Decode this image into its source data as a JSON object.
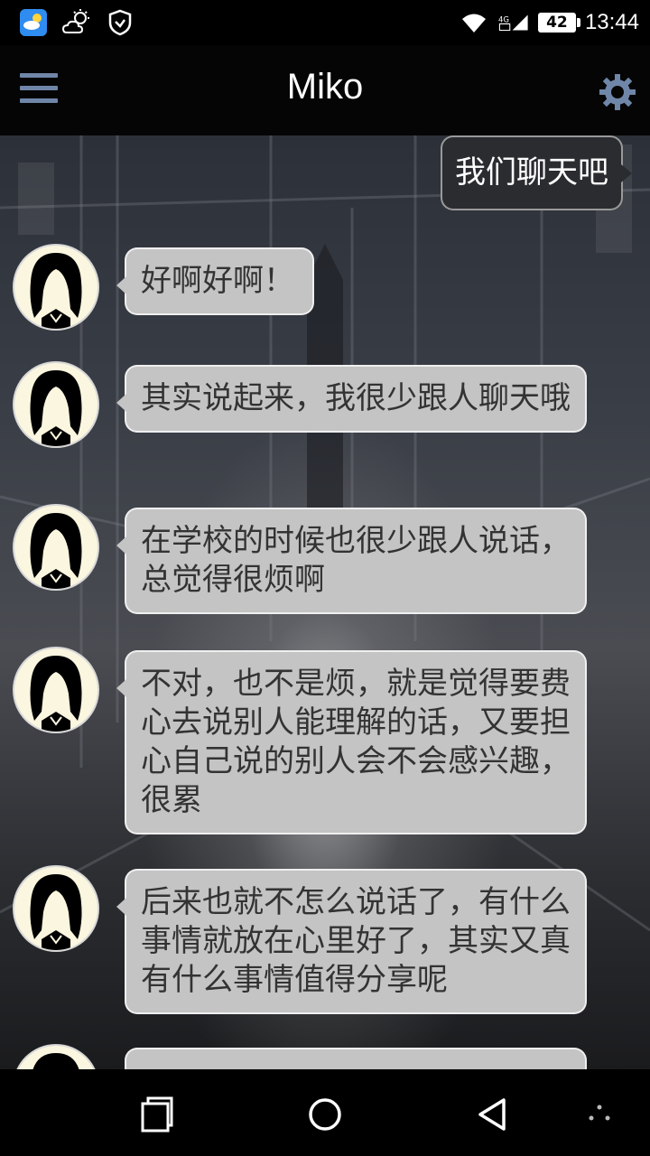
{
  "status_bar": {
    "icons": [
      "weather-app-icon",
      "partly-cloudy-icon",
      "shield-icon",
      "wifi-icon",
      "signal-icon"
    ],
    "battery": "42",
    "time": "13:44"
  },
  "app_bar": {
    "title": "Miko",
    "menu_icon": "menu-icon",
    "settings_icon": "gear-icon"
  },
  "chat": {
    "user_message": "我们聊天吧",
    "bot_messages": [
      "好啊好啊！",
      "其实说起来，我很少跟人聊天哦",
      "在学校的时候也很少跟人说话，总觉得很烦啊",
      "不对，也不是烦，就是觉得要费心去说别人能理解的话，又要担心自己说的别人会不会感兴趣，很累",
      "后来也就不怎么说话了，有什么事情就放在心里好了，其实又真有什么事情值得分享呢"
    ]
  },
  "nav_bar": {
    "buttons": [
      "recent-apps-icon",
      "home-icon",
      "back-icon",
      "more-icon"
    ]
  },
  "colors": {
    "accent": "#6f86a8",
    "bot_bubble": "#c4c4c4",
    "user_bubble": "#2a2c30"
  }
}
